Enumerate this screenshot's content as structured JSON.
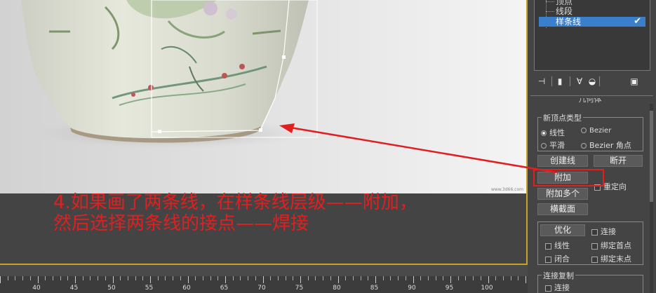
{
  "annotation": {
    "line1": "4.如果画了两条线，在样条线层级——附加，",
    "line2": "然后选择两条线的接点——焊接"
  },
  "viewport": {
    "stamp": "www.3d66.com"
  },
  "panel": {
    "subobject_list": {
      "items": [
        "顶点",
        "线段",
        "样条线"
      ],
      "selected": "样条线"
    },
    "rollout_title": "几何体",
    "new_vertex_type": {
      "title": "新顶点类型",
      "options": [
        "线性",
        "Bezier",
        "平滑",
        "Bezier 角点"
      ],
      "selected": "线性"
    },
    "buttons": {
      "create_line": "创建线",
      "break": "断开",
      "attach": "附加",
      "attach_multi": "附加多个",
      "cross_section": "横截面",
      "optimize": "优化"
    },
    "checkboxes": {
      "reorient": "重定向",
      "connect": "连接",
      "linear": "线性",
      "bind_first": "绑定首点",
      "closed": "闭合",
      "bind_last": "绑定末点",
      "connect2": "连接"
    },
    "connect_copy": {
      "title": "连接复制"
    }
  },
  "timeline": {
    "labels": [
      "40",
      "45",
      "50",
      "55",
      "60",
      "65",
      "70",
      "75",
      "80",
      "85",
      "90",
      "95",
      "100"
    ]
  },
  "colors": {
    "annotation_red": "#e02020",
    "selection_blue": "#3a7fcc",
    "viewport_border": "#c9a22a"
  }
}
